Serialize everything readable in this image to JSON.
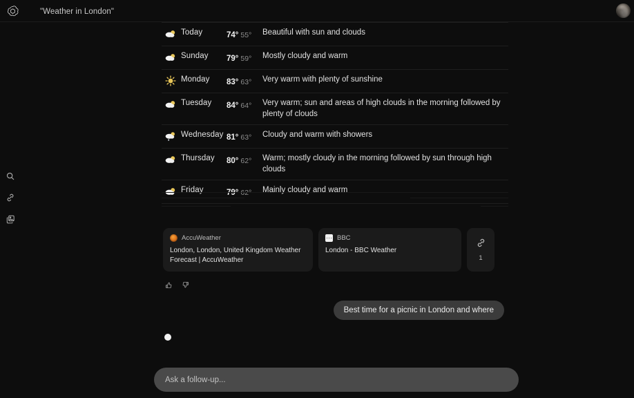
{
  "header": {
    "logo_icon": "openai-logo-icon",
    "title": "\"Weather in London\"",
    "avatar_icon": "user-avatar"
  },
  "rail": {
    "items": [
      {
        "icon": "search-icon",
        "name": "search"
      },
      {
        "icon": "link-icon",
        "name": "links"
      },
      {
        "icon": "stacked-images-icon",
        "name": "images"
      }
    ]
  },
  "weather": {
    "rows": [
      {
        "icon": "cloud-sun-icon",
        "day": "Today",
        "high": "74°",
        "low": "55°",
        "desc": "Beautiful with sun and clouds"
      },
      {
        "icon": "cloud-sun-icon",
        "day": "Sunday",
        "high": "79°",
        "low": "59°",
        "desc": "Mostly cloudy and warm"
      },
      {
        "icon": "sun-icon",
        "day": "Monday",
        "high": "83°",
        "low": "63°",
        "desc": "Very warm with plenty of sunshine"
      },
      {
        "icon": "cloud-sun-icon",
        "day": "Tuesday",
        "high": "84°",
        "low": "64°",
        "desc": "Very warm; sun and areas of high clouds in the morning followed by plenty of clouds"
      },
      {
        "icon": "cloud-rain-icon",
        "day": "Wednesday",
        "high": "81°",
        "low": "63°",
        "desc": "Cloudy and warm with showers"
      },
      {
        "icon": "cloud-sun-icon",
        "day": "Thursday",
        "high": "80°",
        "low": "62°",
        "desc": "Warm; mostly cloudy in the morning followed by sun through high clouds"
      },
      {
        "icon": "cloud-sun-icon",
        "day": "Friday",
        "high": "79°",
        "low": "62°",
        "desc": "Mainly cloudy and warm"
      }
    ]
  },
  "sources": {
    "cards": [
      {
        "favicon": "accuweather-favicon",
        "site": "AccuWeather",
        "title": "London, London, United Kingdom Weather Forecast | AccuWeather"
      },
      {
        "favicon": "bbc-favicon",
        "site": "BBC",
        "title": "London - BBC Weather"
      }
    ],
    "more": {
      "icon": "link-icon",
      "count": "1"
    }
  },
  "feedback": {
    "thumbs_up_icon": "thumbs-up-icon",
    "thumbs_down_icon": "thumbs-down-icon"
  },
  "conversation": {
    "user_message": "Best time for a picnic in London and where"
  },
  "composer": {
    "placeholder": "Ask a follow-up...",
    "value": ""
  },
  "colors": {
    "background": "#0d0d0d",
    "card": "#1b1b1b",
    "bubble": "#3b3b3b",
    "composer": "#4a4a4a",
    "text_primary": "#e3e3e3",
    "text_muted": "#8e8e8e",
    "accent_orange": "#e27a1f"
  }
}
